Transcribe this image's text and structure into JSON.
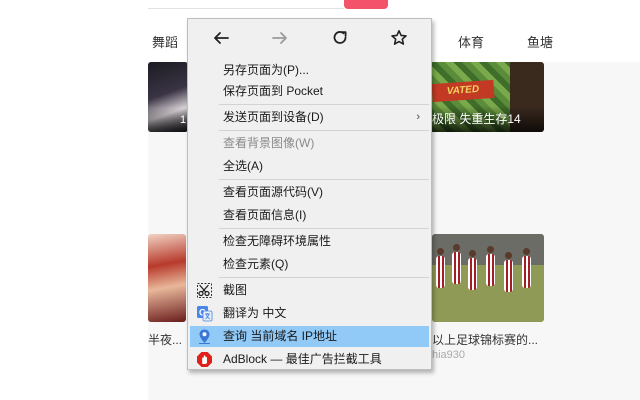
{
  "background": {
    "categories": [
      "舞蹈",
      "体育",
      "鱼塘"
    ],
    "thumb_left_tag": "1",
    "thumb_right_logo": "VATED",
    "thumb_right_caption": "极限 失重生存14",
    "lower_left_caption": "半夜...",
    "lower_right_caption": "以上足球锦标赛的...",
    "lower_right_author": "hia930",
    "accent_color": "#f4526a"
  },
  "context_menu": {
    "nav": {
      "back_icon": "arrow-left",
      "forward_icon": "arrow-right",
      "reload_icon": "reload",
      "bookmark_icon": "star"
    },
    "items": {
      "save_as": "另存页面为(P)...",
      "save_pocket": "保存页面到 Pocket",
      "send_to_device": "发送页面到设备(D)",
      "view_bg_image": "查看背景图像(W)",
      "select_all": "全选(A)",
      "view_source": "查看页面源代码(V)",
      "view_page_info": "查看页面信息(I)",
      "inspect_a11y": "检查无障碍环境属性",
      "inspect_element": "检查元素(Q)",
      "screenshot": "截图",
      "translate": "翻译为 中文",
      "ip_query": "查询 当前域名 IP地址",
      "adblock": "AdBlock — 最佳广告拦截工具"
    },
    "submenu_arrow": "›",
    "hover_color": "#91c9f7"
  }
}
